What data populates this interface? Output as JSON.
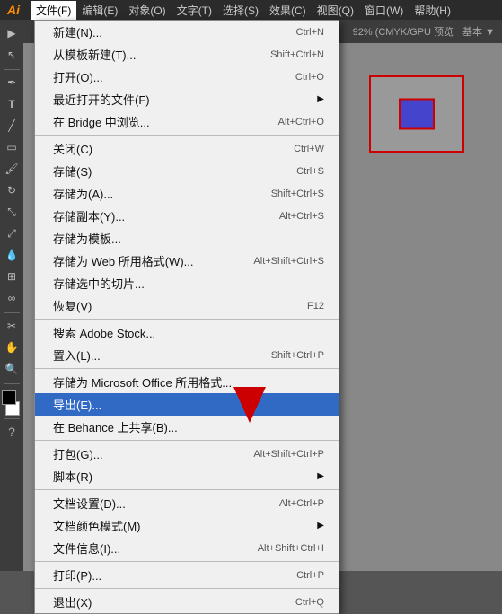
{
  "app": {
    "logo": "Ai",
    "menu_bar": [
      {
        "label": "文件(F)",
        "active": true
      },
      {
        "label": "编辑(E)"
      },
      {
        "label": "对象(O)"
      },
      {
        "label": "文字(T)"
      },
      {
        "label": "选择(S)"
      },
      {
        "label": "效果(C)"
      },
      {
        "label": "视图(Q)"
      },
      {
        "label": "窗口(W)"
      },
      {
        "label": "帮助(H)"
      }
    ]
  },
  "secondary_toolbar": {
    "label": "基本 ▼",
    "zoom": "92% (CMYK/GPU 预览"
  },
  "file_menu": {
    "items": [
      {
        "label": "新建(N)...",
        "shortcut": "Ctrl+N",
        "type": "item"
      },
      {
        "label": "从模板新建(T)...",
        "shortcut": "Shift+Ctrl+N",
        "type": "item"
      },
      {
        "label": "打开(O)...",
        "shortcut": "Ctrl+O",
        "type": "item"
      },
      {
        "label": "最近打开的文件(F)",
        "shortcut": "",
        "arrow": true,
        "type": "item"
      },
      {
        "label": "在 Bridge 中浏览...",
        "shortcut": "Alt+Ctrl+O",
        "type": "item"
      },
      {
        "label": "",
        "type": "separator"
      },
      {
        "label": "关闭(C)",
        "shortcut": "Ctrl+W",
        "type": "item"
      },
      {
        "label": "存储(S)",
        "shortcut": "Ctrl+S",
        "type": "item"
      },
      {
        "label": "存储为(A)...",
        "shortcut": "Shift+Ctrl+S",
        "type": "item"
      },
      {
        "label": "存储副本(Y)...",
        "shortcut": "Alt+Ctrl+S",
        "type": "item"
      },
      {
        "label": "存储为模板...",
        "shortcut": "",
        "type": "item"
      },
      {
        "label": "存储为 Web 所用格式(W)...",
        "shortcut": "Alt+Shift+Ctrl+S",
        "type": "item"
      },
      {
        "label": "存储选中的切片...",
        "shortcut": "",
        "type": "item"
      },
      {
        "label": "恢复(V)",
        "shortcut": "F12",
        "type": "item"
      },
      {
        "label": "",
        "type": "separator"
      },
      {
        "label": "搜索 Adobe Stock...",
        "shortcut": "",
        "type": "item"
      },
      {
        "label": "置入(L)...",
        "shortcut": "Shift+Ctrl+P",
        "type": "item"
      },
      {
        "label": "",
        "type": "separator"
      },
      {
        "label": "存储为 Microsoft Office 所用格式...",
        "shortcut": "",
        "type": "item"
      },
      {
        "label": "导出(E)...",
        "shortcut": "",
        "type": "item",
        "highlighted": true
      },
      {
        "label": "在 Behance 上共享(B)...",
        "shortcut": "",
        "type": "item"
      },
      {
        "label": "",
        "type": "separator"
      },
      {
        "label": "打包(G)...",
        "shortcut": "Alt+Shift+Ctrl+P",
        "type": "item"
      },
      {
        "label": "脚本(R)",
        "shortcut": "",
        "arrow": true,
        "type": "item"
      },
      {
        "label": "",
        "type": "separator"
      },
      {
        "label": "文档设置(D)...",
        "shortcut": "Alt+Ctrl+P",
        "type": "item"
      },
      {
        "label": "文档颜色模式(M)",
        "shortcut": "",
        "arrow": true,
        "type": "item"
      },
      {
        "label": "文件信息(I)...",
        "shortcut": "Alt+Shift+Ctrl+I",
        "type": "item"
      },
      {
        "label": "",
        "type": "separator"
      },
      {
        "label": "打印(P)...",
        "shortcut": "Ctrl+P",
        "type": "item"
      },
      {
        "label": "",
        "type": "separator"
      },
      {
        "label": "退出(X)",
        "shortcut": "Ctrl+Q",
        "type": "item"
      }
    ]
  },
  "tools": [
    "cursor",
    "direct-select",
    "magic-wand",
    "pen",
    "text",
    "line",
    "rect",
    "rotate",
    "scale",
    "puppet",
    "eyedrop",
    "measure",
    "hand",
    "zoom",
    "question"
  ]
}
